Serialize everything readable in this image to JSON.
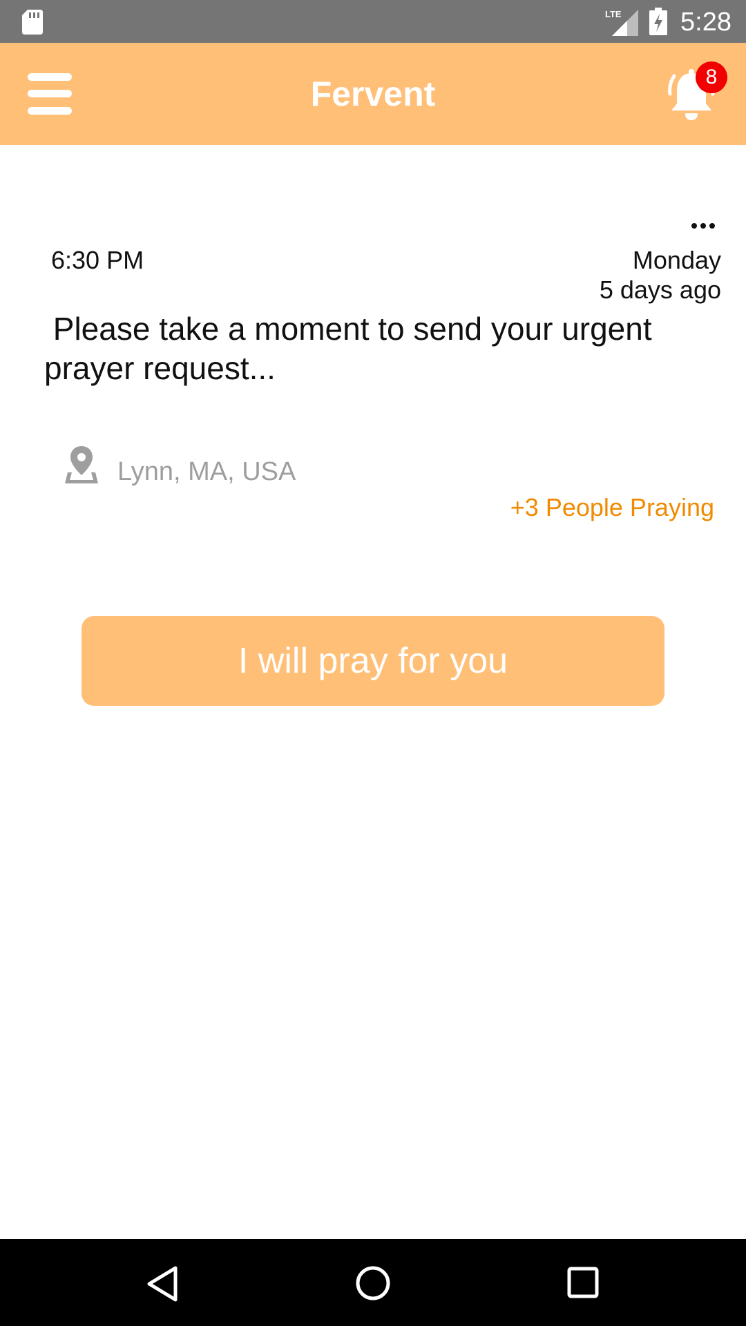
{
  "status_bar": {
    "time": "5:28",
    "network": "LTE",
    "icons": [
      "sd-card-icon",
      "lte-signal-icon",
      "battery-charging-icon"
    ]
  },
  "app_bar": {
    "title": "Fervent",
    "notification_count": "8",
    "icons": [
      "menu-icon",
      "bell-icon"
    ]
  },
  "post": {
    "time": "6:30 PM",
    "day": "Monday",
    "ago": "5 days ago",
    "message": " Please take a moment to send your urgent\nprayer request...",
    "location": "Lynn, MA, USA",
    "praying": "+3 People Praying",
    "icons": [
      "more-icon",
      "location-pin-icon"
    ]
  },
  "actions": {
    "pray_label": "I will pray for you"
  },
  "nav_bar": {
    "icons": [
      "back-icon",
      "home-icon",
      "recent-apps-icon"
    ]
  },
  "colors": {
    "accent": "#ffbf77",
    "praying_text": "#f08a00",
    "badge": "#f00000",
    "status_bar": "#757575",
    "muted_text": "#9e9e9e"
  }
}
